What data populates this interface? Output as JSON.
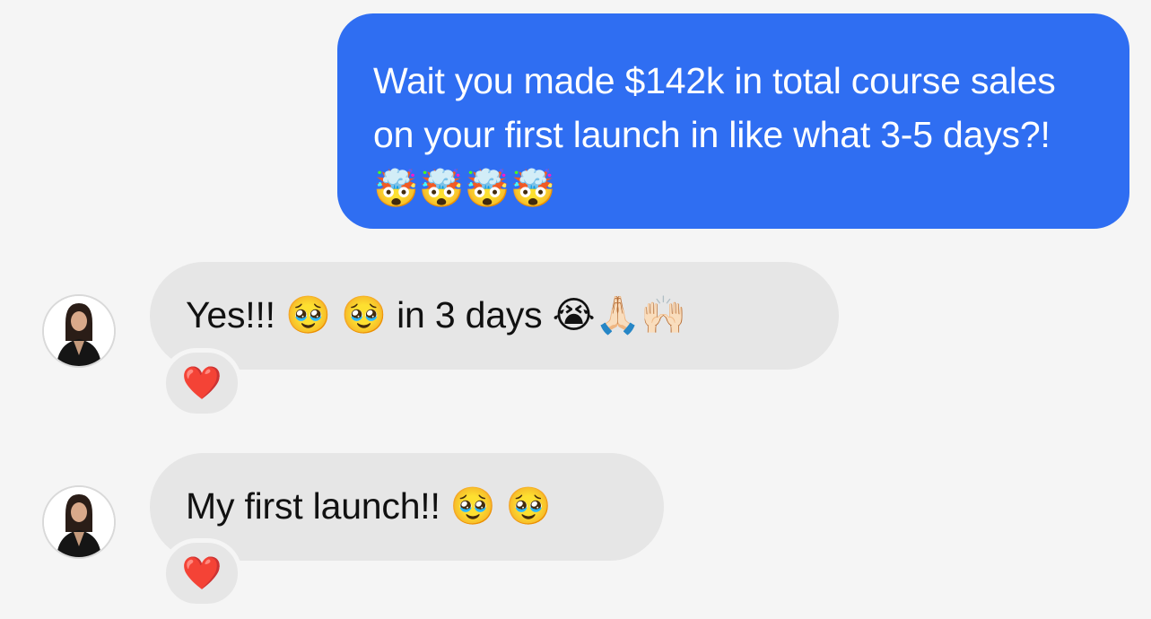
{
  "messages": {
    "outgoing": {
      "text": "Wait you made $142k in total course sales on your first launch in like what 3-5 days?! 🤯🤯🤯🤯"
    },
    "incoming": [
      {
        "text": "Yes!!! 🥹 🥹  in 3 days 😭🙏🏻🙌🏻",
        "reaction": "❤️"
      },
      {
        "text": "My first launch!! 🥹 🥹",
        "reaction": "❤️"
      }
    ]
  },
  "colors": {
    "background": "#f5f5f5",
    "outgoing_bubble": "#2f6ef2",
    "incoming_bubble": "#e6e6e6",
    "reaction_heart": "#e0202e"
  },
  "icons": {
    "avatar": "profile-photo-woman-icon",
    "reaction": "red-heart-icon"
  }
}
